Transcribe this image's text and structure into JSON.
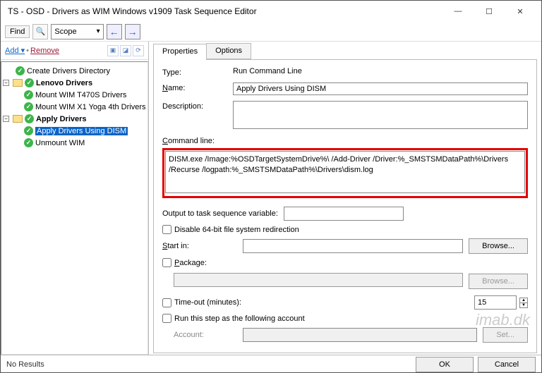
{
  "window": {
    "title": "TS - OSD - Drivers as WIM Windows v1909 Task Sequence Editor"
  },
  "toolbar": {
    "find": "Find",
    "scope": "Scope"
  },
  "left": {
    "add": "Add",
    "remove": "Remove",
    "tree": {
      "node0": "Create Drivers Directory",
      "node1": "Lenovo Drivers",
      "node1a": "Mount WIM T470S Drivers",
      "node1b": "Mount WIM X1 Yoga 4th Drivers",
      "node2": "Apply Drivers",
      "node2a": "Apply Drivers Using DISM",
      "node2b": "Unmount WIM"
    }
  },
  "tabs": {
    "properties": "Properties",
    "options": "Options"
  },
  "form": {
    "type_label": "Type:",
    "type_value": "Run Command Line",
    "name_label": "Name:",
    "name_value": "Apply Drivers Using DISM",
    "desc_label": "Description:",
    "desc_value": "",
    "cmd_label": "Command line:",
    "cmd_value": "DISM.exe /Image:%OSDTargetSystemDrive%\\ /Add-Driver /Driver:%_SMSTSMDataPath%\\Drivers /Recurse /logpath:%_SMSTSMDataPath%\\Drivers\\dism.log",
    "output_label": "Output to task sequence variable:",
    "output_value": "",
    "disable64": "Disable 64-bit file system redirection",
    "startin_label": "Start in:",
    "startin_value": "",
    "browse": "Browse...",
    "package_label": "Package:",
    "timeout_label": "Time-out (minutes):",
    "timeout_value": "15",
    "runas_label": "Run this step as the following account",
    "account_label": "Account:",
    "set_btn": "Set..."
  },
  "footer": {
    "status": "No Results",
    "ok": "OK",
    "cancel": "Cancel"
  },
  "watermark": "imab.dk"
}
